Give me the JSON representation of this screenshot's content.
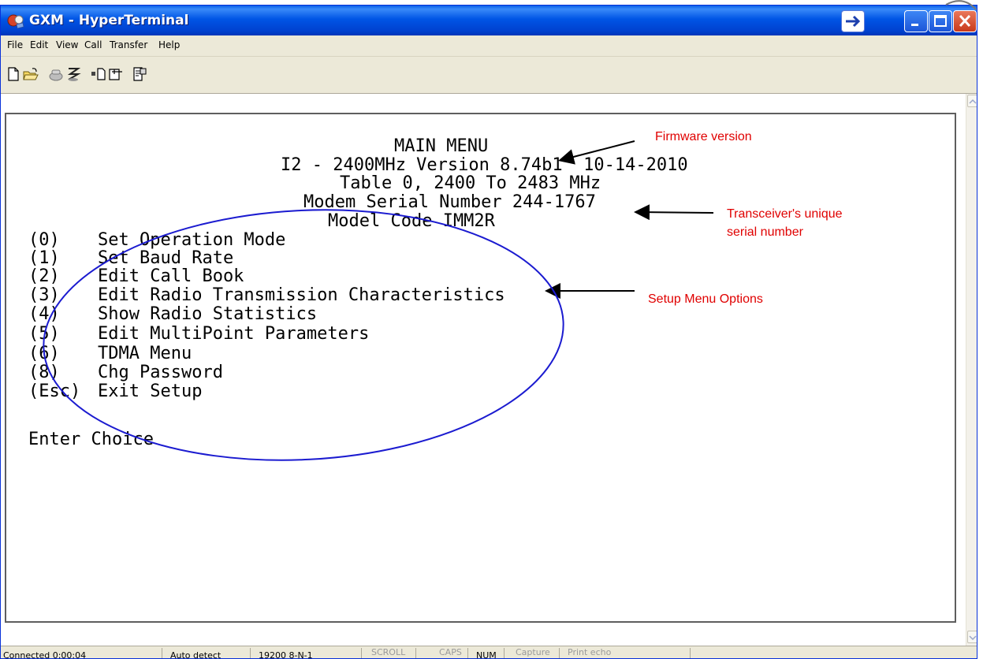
{
  "window": {
    "title": "GXM - HyperTerminal"
  },
  "menubar": {
    "items": [
      "File",
      "Edit",
      "View",
      "Call",
      "Transfer",
      "Help"
    ]
  },
  "toolbar": {
    "icons": [
      "new-icon",
      "open-icon",
      "dial-icon",
      "disconnect-icon",
      "send-icon",
      "receive-icon",
      "properties-icon"
    ]
  },
  "terminal": {
    "header": [
      "MAIN MENU",
      "I2 - 2400MHz Version 8.74b1  10-14-2010",
      "Table 0, 2400 To 2483 MHz",
      "Modem Serial Number 244-1767",
      "Model Code IMM2R"
    ],
    "options": [
      {
        "key": "(0)",
        "label": "Set Operation Mode"
      },
      {
        "key": "(1)",
        "label": "Set Baud Rate"
      },
      {
        "key": "(2)",
        "label": "Edit Call Book"
      },
      {
        "key": "(3)",
        "label": "Edit Radio Transmission Characteristics"
      },
      {
        "key": "(4)",
        "label": "Show Radio Statistics"
      },
      {
        "key": "(5)",
        "label": "Edit MultiPoint Parameters"
      },
      {
        "key": "(6)",
        "label": "TDMA Menu"
      },
      {
        "key": "(8)",
        "label": "Chg Password"
      },
      {
        "key": "(Esc)",
        "label": "Exit Setup"
      }
    ],
    "prompt": "Enter Choice"
  },
  "annotations": {
    "firmware": "Firmware version",
    "serial_line1": "Transceiver's unique",
    "serial_line2": "serial number",
    "setup": "Setup Menu Options",
    "color": "#e00000",
    "ellipse_color": "#1b1bd0"
  },
  "statusbar": {
    "connected": "Connected 0:00:04",
    "detect": "Auto detect",
    "settings": "19200 8-N-1",
    "scroll": "SCROLL",
    "caps": "CAPS",
    "num": "NUM",
    "capture": "Capture",
    "print_echo": "Print echo"
  }
}
